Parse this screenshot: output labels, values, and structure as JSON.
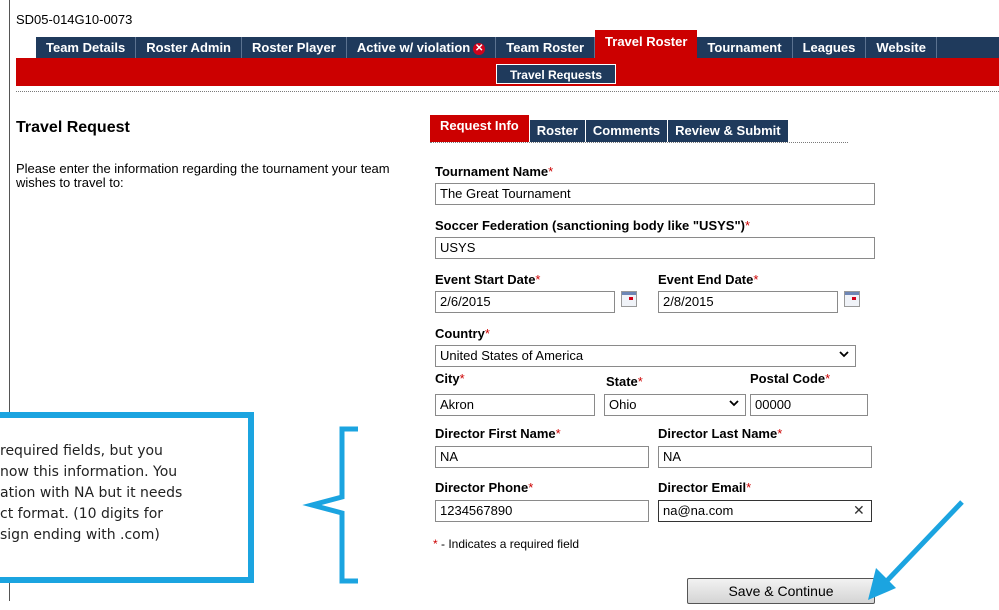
{
  "team_id": "SD05-014G10-0073",
  "top_tabs": [
    {
      "label": "Team Details"
    },
    {
      "label": "Roster Admin"
    },
    {
      "label": "Roster Player"
    },
    {
      "label": "Active w/ violation"
    },
    {
      "label": "Team Roster"
    },
    {
      "label": "Travel Roster"
    },
    {
      "label": "Tournament"
    },
    {
      "label": "Leagues"
    },
    {
      "label": "Website"
    }
  ],
  "sub_tab": "Travel Requests",
  "page_title": "Travel Request",
  "request_tabs": [
    "Request Info",
    "Roster",
    "Comments",
    "Review & Submit"
  ],
  "intro_text": "Please enter the information regarding the tournament your team wishes to travel to:",
  "form": {
    "tournament_name_label": "Tournament Name",
    "tournament_name": "The Great Tournament",
    "federation_label": "Soccer Federation (sanctioning body like \"USYS\")",
    "federation": "USYS",
    "start_date_label": "Event Start Date",
    "start_date": "2/6/2015",
    "end_date_label": "Event End Date",
    "end_date": "2/8/2015",
    "country_label": "Country",
    "country": "United States of America",
    "city_label": "City",
    "city": "Akron",
    "state_label": "State",
    "state": "Ohio",
    "postal_label": "Postal Code",
    "postal": "00000",
    "dir_first_label": "Director First Name",
    "dir_first": "NA",
    "dir_last_label": "Director Last Name",
    "dir_last": "NA",
    "dir_phone_label": "Director Phone",
    "dir_phone": "1234567890",
    "dir_email_label": "Director Email",
    "dir_email": "na@na.com",
    "required_mark": "*",
    "required_note": " - Indicates a required field",
    "save_label": "Save & Continue"
  },
  "annotation": {
    "lines": [
      " required fields, but you",
      "now this information. You",
      "ation with NA but it needs",
      "ct format. (10 digits for",
      "sign ending with .com)"
    ]
  },
  "colors": {
    "navy": "#1f3a5c",
    "red": "#cc0000",
    "annotation_blue": "#1ba4e0"
  }
}
